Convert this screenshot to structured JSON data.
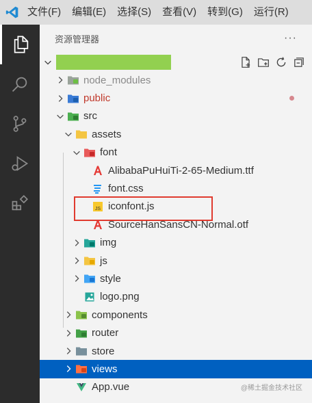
{
  "menubar": {
    "items": [
      "文件(F)",
      "编辑(E)",
      "选择(S)",
      "查看(V)",
      "转到(G)",
      "运行(R)"
    ]
  },
  "activitybar": {
    "items": [
      "explorer-icon",
      "search-icon",
      "source-control-icon",
      "run-debug-icon",
      "extensions-icon"
    ]
  },
  "sidebar": {
    "title": "资源管理器",
    "more_label": "···",
    "project_actions": [
      "new-file-icon",
      "new-folder-icon",
      "refresh-icon",
      "collapse-all-icon"
    ]
  },
  "tree": [
    {
      "label": "node_modules",
      "level": 0,
      "kind": "folder",
      "expanded": false,
      "icon": "folder-node-icon",
      "color": "#8a8a8a"
    },
    {
      "label": "public",
      "level": 0,
      "kind": "folder",
      "expanded": false,
      "icon": "folder-public-icon",
      "color": "#c0392b",
      "modified": true
    },
    {
      "label": "src",
      "level": 0,
      "kind": "folder",
      "expanded": true,
      "icon": "folder-src-icon"
    },
    {
      "label": "assets",
      "level": 1,
      "kind": "folder",
      "expanded": true,
      "icon": "folder-assets-icon"
    },
    {
      "label": "font",
      "level": 2,
      "kind": "folder",
      "expanded": true,
      "icon": "folder-font-icon"
    },
    {
      "label": "AlibabaPuHuiTi-2-65-Medium.ttf",
      "level": 3,
      "kind": "file",
      "icon": "font-file-icon"
    },
    {
      "label": "font.css",
      "level": 3,
      "kind": "file",
      "icon": "css-file-icon"
    },
    {
      "label": "iconfont.js",
      "level": 3,
      "kind": "file",
      "icon": "js-file-icon",
      "highlighted": true
    },
    {
      "label": "SourceHanSansCN-Normal.otf",
      "level": 3,
      "kind": "file",
      "icon": "font-file-icon"
    },
    {
      "label": "img",
      "level": 2,
      "kind": "folder",
      "expanded": false,
      "icon": "folder-img-icon"
    },
    {
      "label": "js",
      "level": 2,
      "kind": "folder",
      "expanded": false,
      "icon": "folder-js-icon"
    },
    {
      "label": "style",
      "level": 2,
      "kind": "folder",
      "expanded": false,
      "icon": "folder-style-icon"
    },
    {
      "label": "logo.png",
      "level": 2,
      "kind": "file",
      "icon": "image-file-icon"
    },
    {
      "label": "components",
      "level": 1,
      "kind": "folder",
      "expanded": false,
      "icon": "folder-components-icon"
    },
    {
      "label": "router",
      "level": 1,
      "kind": "folder",
      "expanded": false,
      "icon": "folder-router-icon"
    },
    {
      "label": "store",
      "level": 1,
      "kind": "folder",
      "expanded": false,
      "icon": "folder-store-icon"
    },
    {
      "label": "views",
      "level": 1,
      "kind": "folder",
      "expanded": false,
      "icon": "folder-views-icon",
      "selected": true
    },
    {
      "label": "App.vue",
      "level": 1,
      "kind": "file",
      "icon": "vue-file-icon"
    }
  ],
  "watermark": "@稀土掘金技术社区",
  "colors": {
    "menubar_bg": "#dddddd",
    "activitybar_bg": "#2c2c2c",
    "sidebar_bg": "#f3f3f3",
    "selection": "#0060c0",
    "highlight_box": "#e03a2e",
    "project_name_bar": "#92d050"
  }
}
